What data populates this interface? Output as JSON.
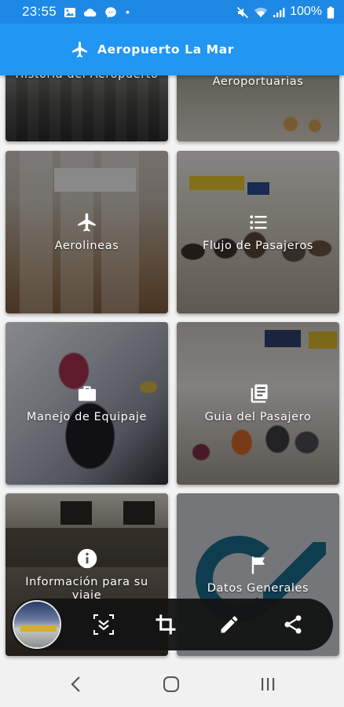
{
  "status_bar": {
    "time": "23:55",
    "battery": "100%",
    "icons": [
      "image-icon",
      "cloud-icon",
      "messenger-icon",
      "dot-icon",
      "mute-icon",
      "wifi-icon",
      "signal-icon",
      "battery-icon"
    ]
  },
  "app_bar": {
    "icon": "airplane-icon",
    "title": "Aeropuerto La Mar"
  },
  "tiles": [
    {
      "label": "Historia del Aeropuerto",
      "icon": "",
      "color": "#5a5a58"
    },
    {
      "label": "Aeroportuarias",
      "icon": "",
      "color": "#8a8278"
    },
    {
      "label": "Aerolineas",
      "icon": "airplane-icon",
      "color": "#6e5a4a"
    },
    {
      "label": "Flujo de Pasajeros",
      "icon": "list-icon",
      "color": "#7a7466"
    },
    {
      "label": "Manejo de Equipaje",
      "icon": "briefcase-icon",
      "color": "#6a7080"
    },
    {
      "label": "Guia del Pasajero",
      "icon": "article-icon",
      "color": "#6c6a66"
    },
    {
      "label": "Información para su viaje",
      "icon": "info-icon",
      "color": "#4a4640"
    },
    {
      "label": "Datos Generales",
      "icon": "flag-icon",
      "color": "#8c8f92"
    }
  ],
  "screenshot_toolbar": {
    "buttons": [
      "scroll-capture-icon",
      "crop-icon",
      "edit-icon",
      "share-icon"
    ]
  },
  "nav_bar": {
    "buttons": [
      "back-icon",
      "home-icon",
      "recents-icon"
    ]
  }
}
